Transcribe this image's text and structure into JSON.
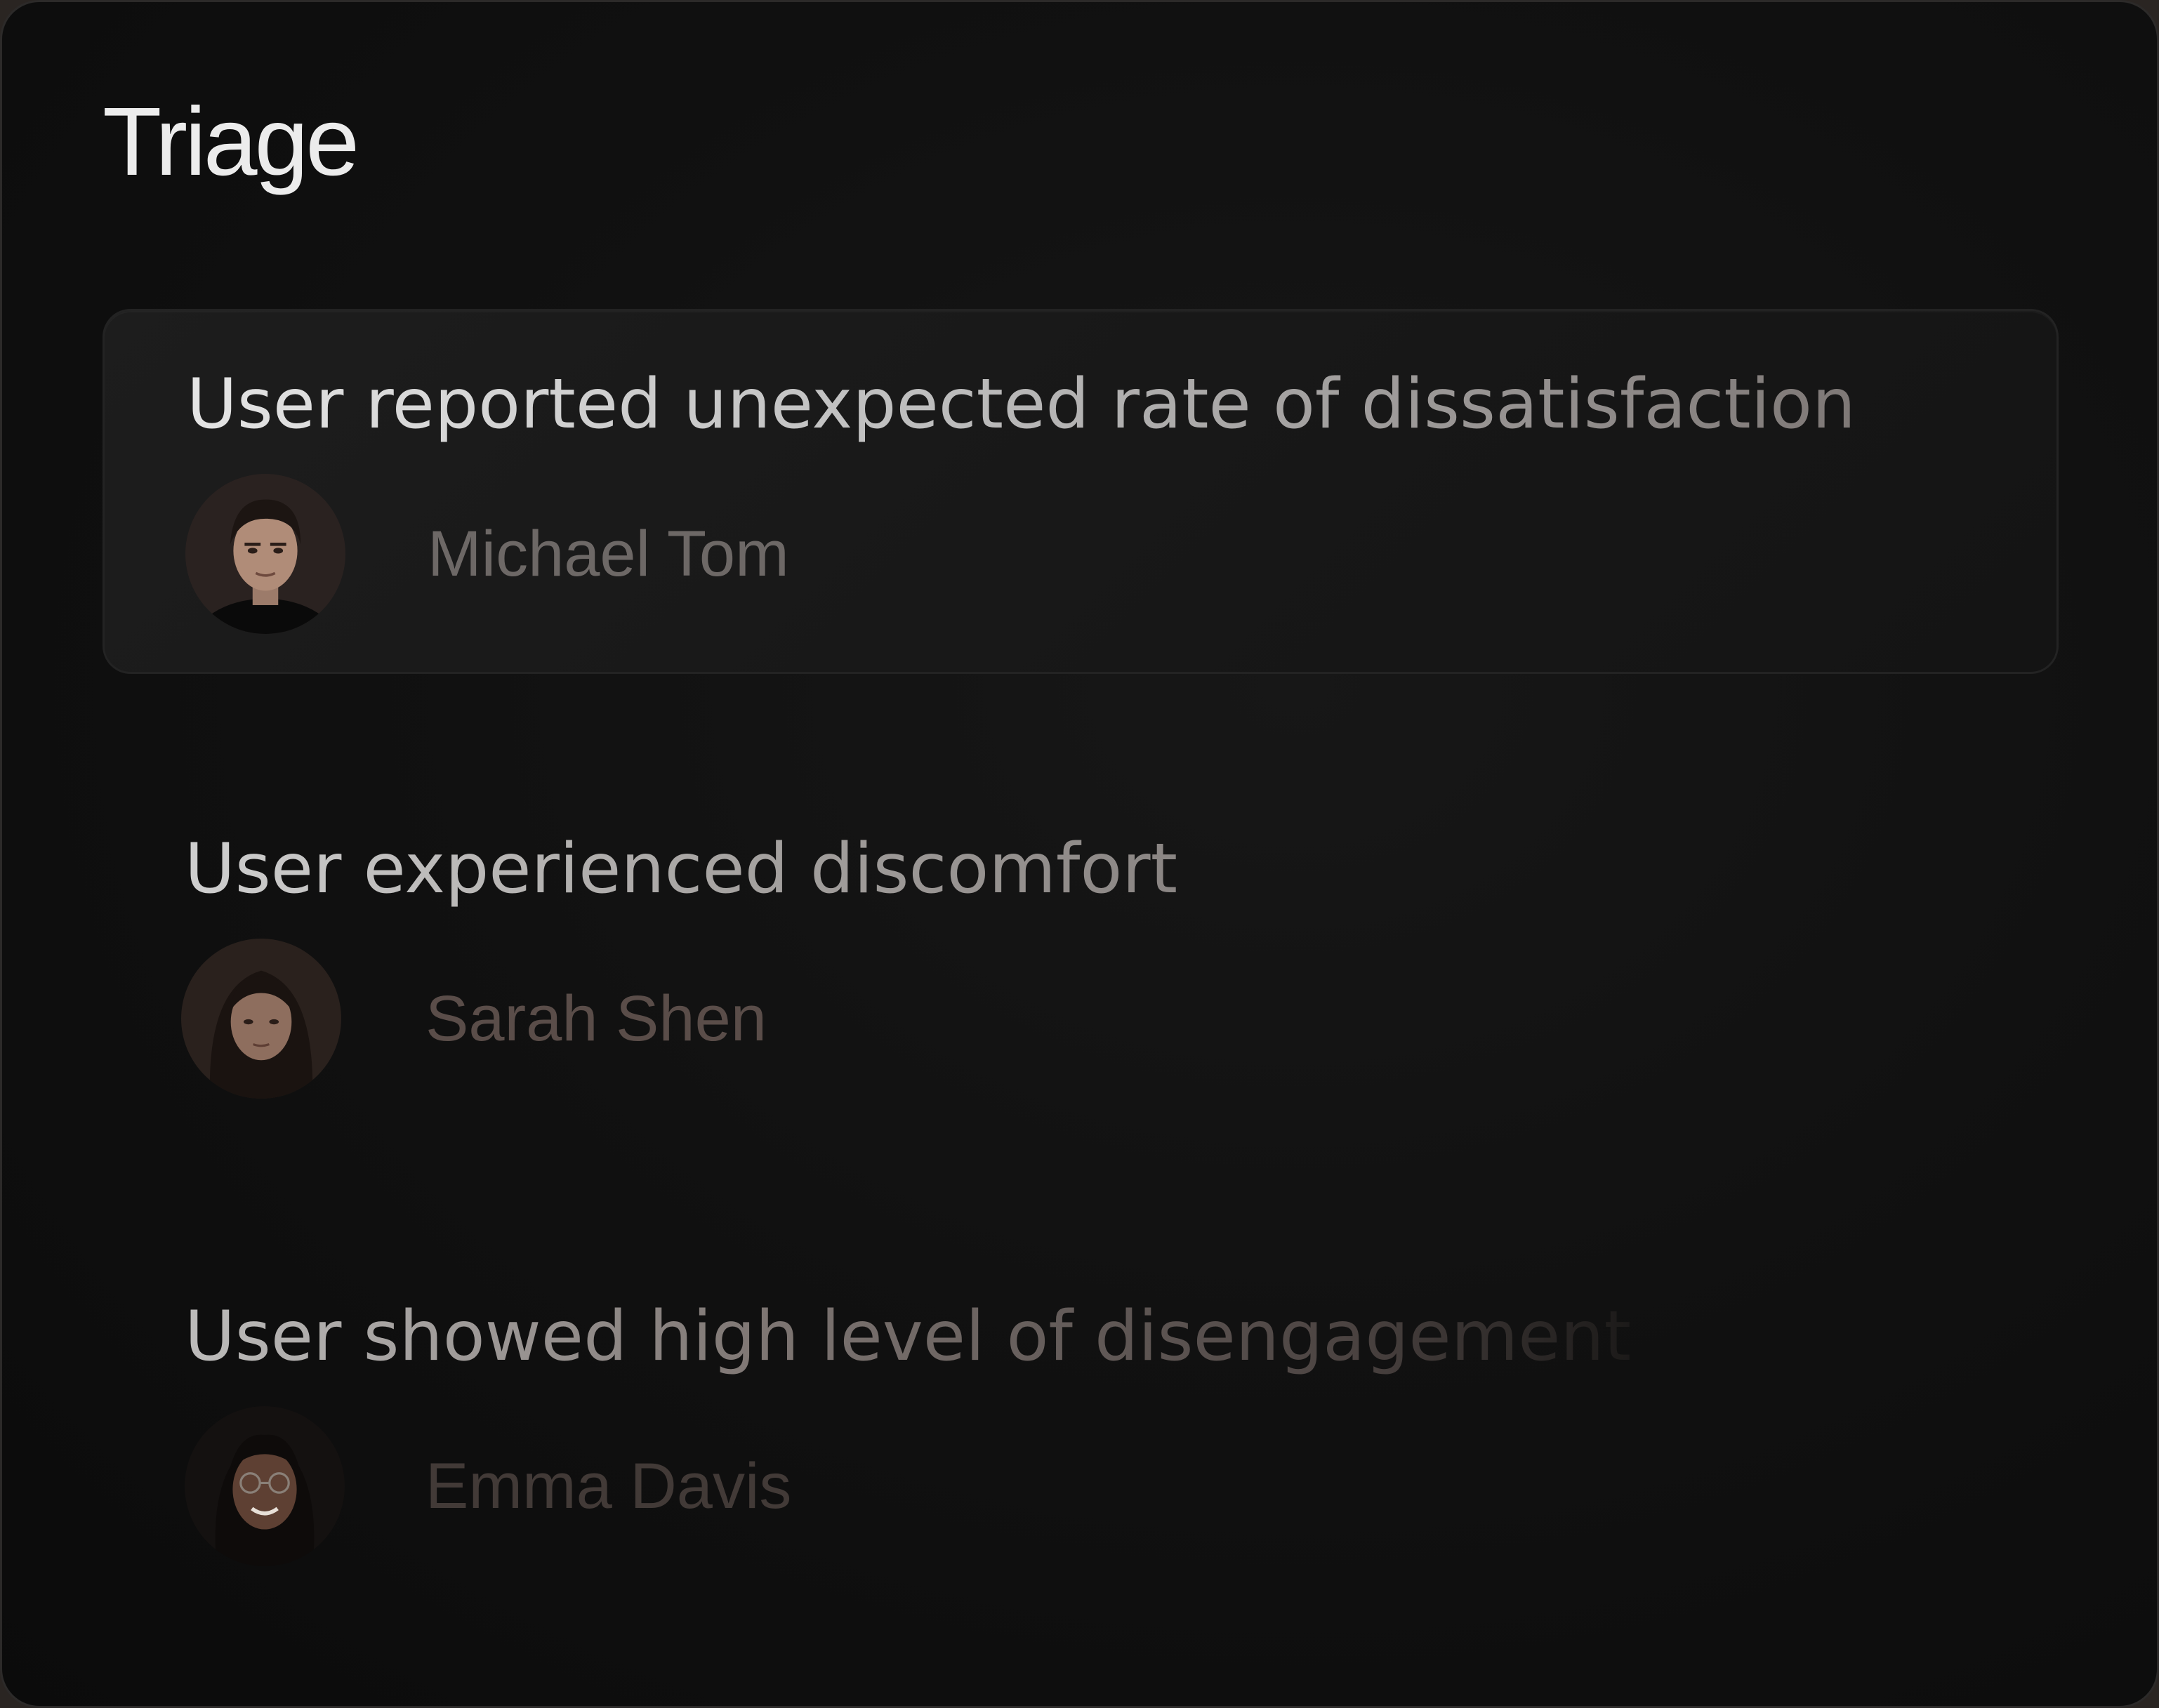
{
  "header": {
    "title": "Triage"
  },
  "items": [
    {
      "issue": "User reported unexpected rate of dissatisfaction",
      "person": "Michael Tom",
      "selected": true
    },
    {
      "issue": "User experienced discomfort",
      "person": "Sarah Shen",
      "selected": false
    },
    {
      "issue": "User showed high level of disengagement",
      "person": "Emma Davis",
      "selected": false
    }
  ],
  "colors": {
    "background": "#111111",
    "card": "#1b1b1b",
    "title": "#ececec"
  }
}
